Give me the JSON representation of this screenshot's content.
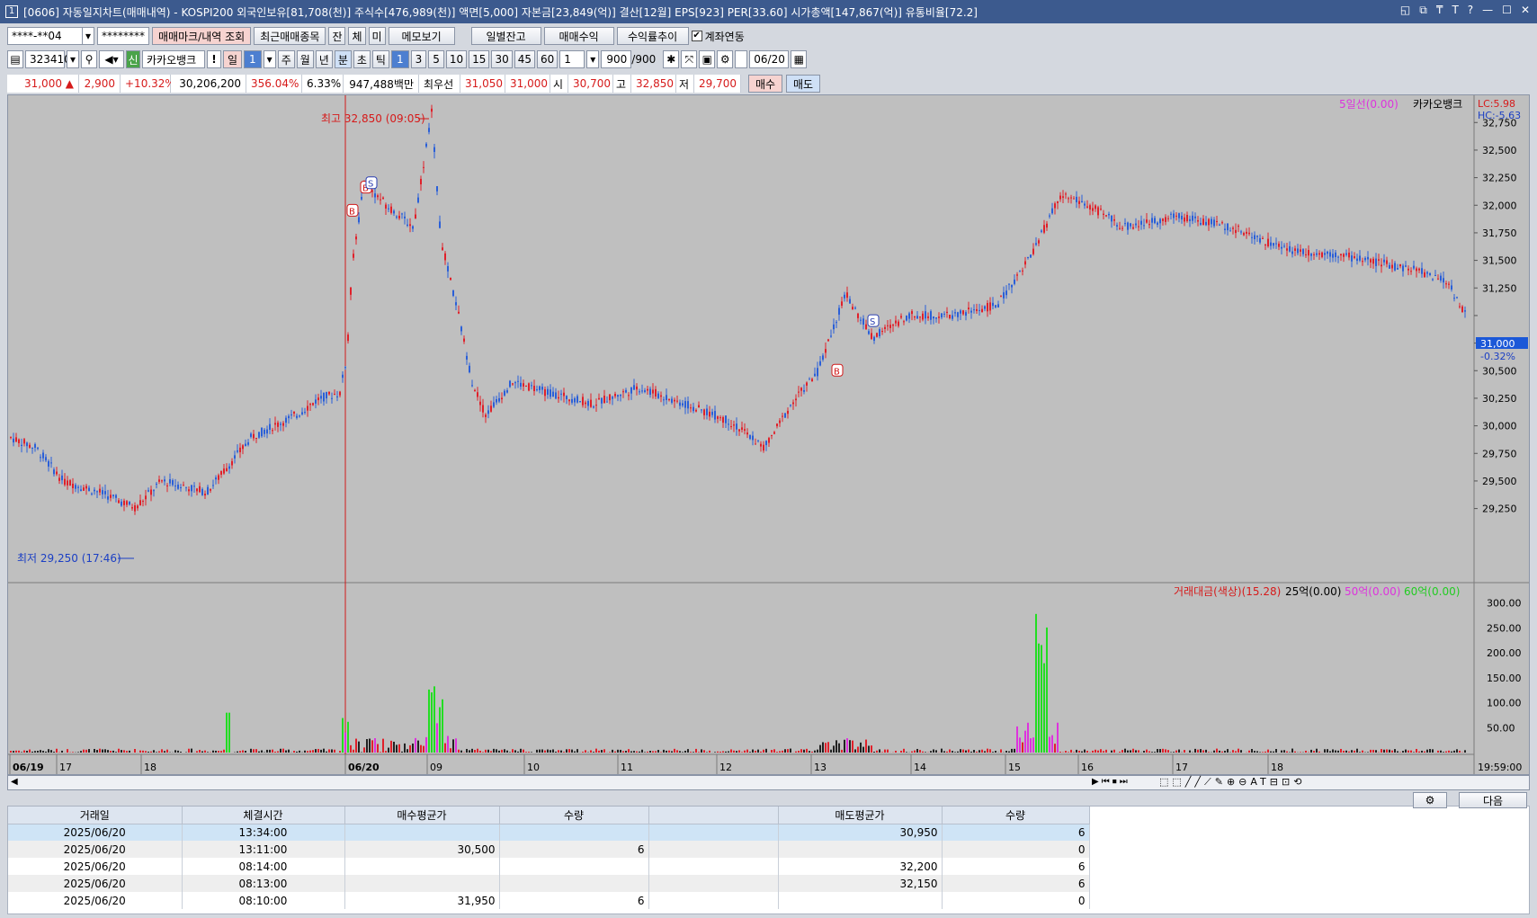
{
  "titlebar": {
    "num": "1",
    "title": "[0606] 자동일지차트(매매내역) - KOSPI200 외국인보유[81,708(천)] 주식수[476,989(천)] 액면[5,000] 자본금[23,849(억)] 결산[12월] EPS[923] PER[33.60] 시가총액[147,867(억)] 유통비율[72.2]",
    "btns": [
      "◱",
      "⧉",
      "₸",
      "T",
      "?",
      "—",
      "☐",
      "✕"
    ]
  },
  "toolbar1": {
    "account": "****-**04",
    "password": "********",
    "btn_marks": "매매마크/내역 조회",
    "btn_recent": "최근매매종목",
    "btn_jan": "잔",
    "btn_che": "체",
    "btn_mi": "미",
    "btn_memo": "메모보기",
    "btn_daily": "일별잔고",
    "btn_profit": "매매수익",
    "btn_rate": "수익률추이",
    "link_label": "계좌연동",
    "link_checked": "✔"
  },
  "toolbar2": {
    "code": "323410",
    "badge": "신",
    "stock": "카카오뱅크",
    "bang": "!",
    "day": "일",
    "num_sel": "1",
    "periods": [
      "주",
      "월",
      "년",
      "분",
      "초",
      "틱"
    ],
    "mins": [
      "1",
      "3",
      "5",
      "10",
      "15",
      "30",
      "45",
      "60"
    ],
    "count": "1",
    "range": "900",
    "range_total": "/900",
    "date": "06/20"
  },
  "info": {
    "price": "31,000 ▲",
    "change": "2,900",
    "rate": "+10.32%",
    "volume": "30,206,200",
    "vol_rate": "356.04%",
    "turnover": "6.33%",
    "amount": "947,488백만",
    "best_label": "최우선",
    "best_ask": "31,050",
    "best_bid": "31,000",
    "open_label": "시",
    "open": "30,700",
    "high_label": "고",
    "high": "32,850",
    "low_label": "저",
    "low": "29,700",
    "buy": "매수",
    "sell": "매도"
  },
  "chart": {
    "legend_ma": "5일선(0.00)",
    "legend_name": "카카오뱅크",
    "lc": "LC:5.98",
    "hc": "HC:-5.63",
    "price_ticks": [
      "32,750",
      "32,500",
      "32,250",
      "32,000",
      "31,750",
      "31,500",
      "31,250",
      "31,000",
      "30,750",
      "30,500",
      "30,250",
      "30,000",
      "29,750",
      "29,500",
      "29,250"
    ],
    "cur_price": "31,000",
    "cur_rate": "-0.32%",
    "high_note": "최고 32,850 (09:05)",
    "low_note": "최저 29,250 (17:46)",
    "vol_legend": {
      "amt": "거래대금(색상)(15.28)",
      "ma25": "25억(0.00)",
      "ma50": "50억(0.00)",
      "ma60": "60억(0.00)"
    },
    "vol_ticks": [
      "300.00",
      "250.00",
      "200.00",
      "150.00",
      "100.00",
      "50.00"
    ],
    "x_labels": [
      "06/19",
      "17",
      "18",
      "06/20",
      "09",
      "10",
      "11",
      "12",
      "13",
      "14",
      "15",
      "16",
      "17",
      "18"
    ],
    "time_label": "19:59:00",
    "colors": {
      "up": "#e0202a",
      "down": "#2a5fd8",
      "volspike": "#22dd22",
      "volmag": "#dd33dd",
      "bg": "#bfbfbf"
    }
  },
  "chart_data": {
    "type": "candlestick",
    "x": [
      "06/19 17",
      "06/19 18",
      "06/20 08",
      "06/20 09",
      "06/20 10",
      "06/20 11",
      "06/20 12",
      "06/20 13",
      "06/20 14",
      "06/20 15",
      "06/20 16",
      "06/20 17",
      "06/20 18"
    ],
    "close": [
      29900,
      30400,
      31200,
      30800,
      30200,
      30300,
      30050,
      30850,
      30950,
      31900,
      31900,
      31600,
      31000
    ],
    "high_value": 32850,
    "low_value": 29250,
    "ylim": [
      29100,
      32850
    ]
  },
  "grid": {
    "headers": [
      "거래일",
      "체결시간",
      "매수평균가",
      "수량",
      "",
      "매도평균가",
      "수량"
    ],
    "rows": [
      [
        "2025/06/20",
        "13:34:00",
        "",
        "",
        "",
        "30,950",
        "6"
      ],
      [
        "2025/06/20",
        "13:11:00",
        "30,500",
        "6",
        "",
        "",
        "0"
      ],
      [
        "2025/06/20",
        "08:14:00",
        "",
        "",
        "",
        "32,200",
        "6"
      ],
      [
        "2025/06/20",
        "08:13:00",
        "",
        "",
        "",
        "32,150",
        "6"
      ],
      [
        "2025/06/20",
        "08:10:00",
        "31,950",
        "6",
        "",
        "",
        "0"
      ]
    ],
    "next_btn": "다음"
  }
}
